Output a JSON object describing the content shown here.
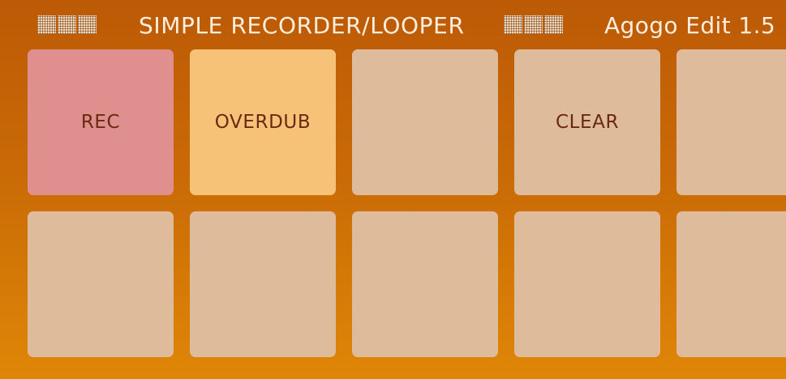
{
  "header": {
    "title": "SIMPLE RECORDER/LOOPER",
    "version": "Agogo Edit 1.5",
    "decoration_icon": "checker-pattern-icon"
  },
  "pads": {
    "row1": [
      "REC",
      "OVERDUB",
      "",
      "CLEAR",
      ""
    ],
    "row2": [
      "",
      "",
      "",
      "",
      ""
    ]
  },
  "colors": {
    "background_top": "#bc5a06",
    "background_bottom": "#df8607",
    "pad_default": "#ddbb9b",
    "pad_rec": "#de8f8e",
    "pad_overdub": "#f6c278",
    "pad_text": "#6b2a10",
    "header_text": "#fbeedd"
  }
}
